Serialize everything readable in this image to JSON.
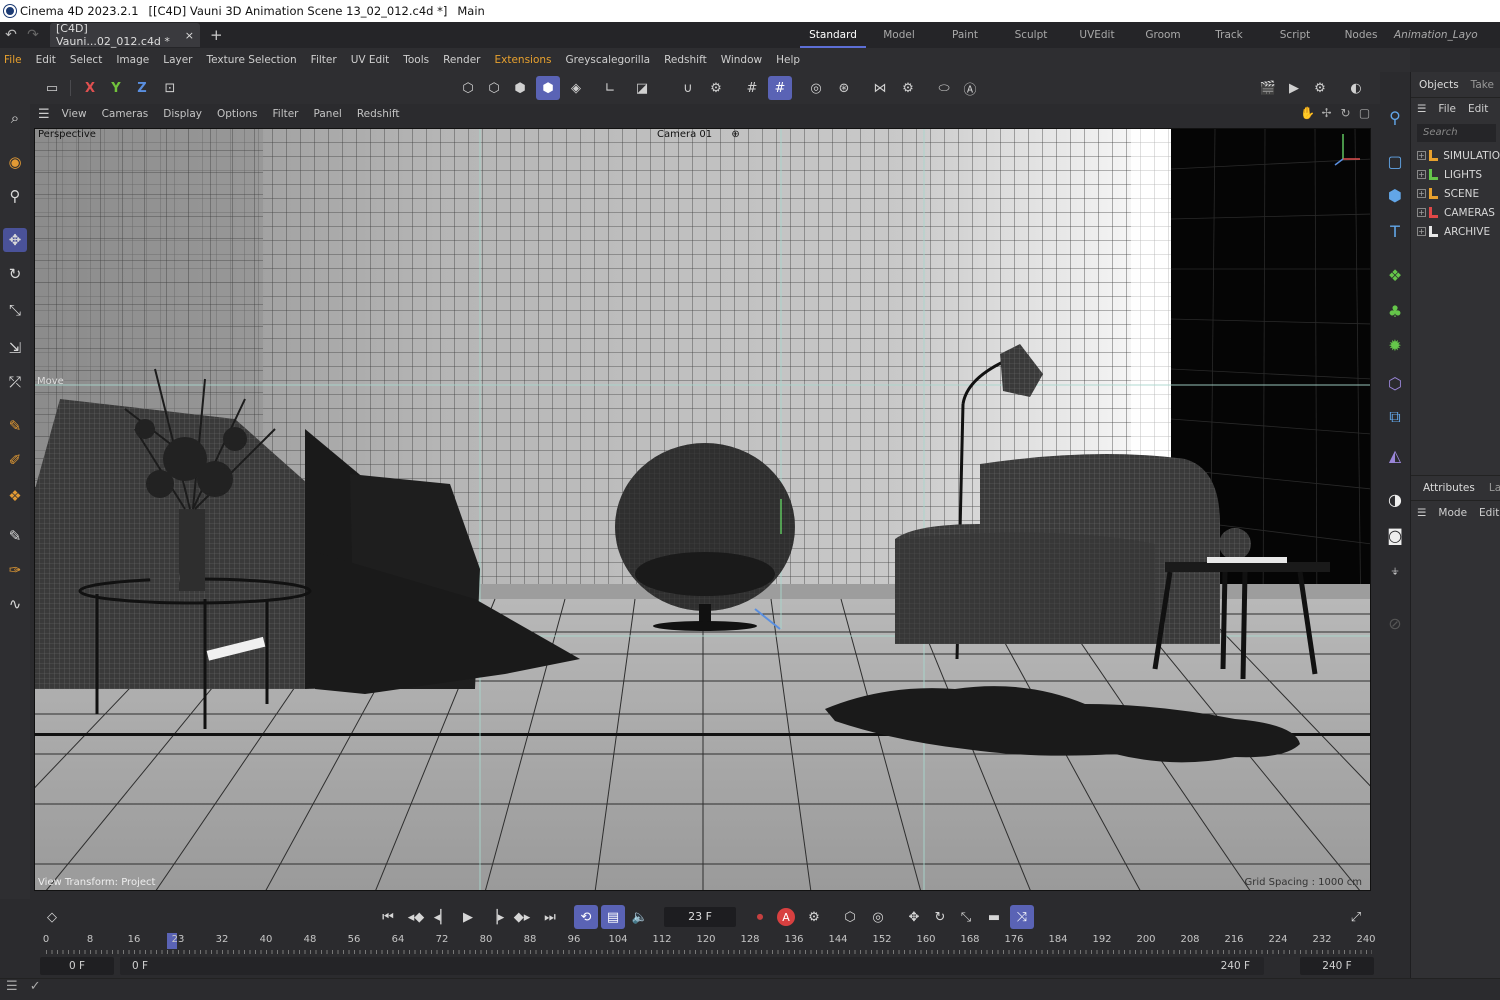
{
  "window": {
    "app_version": "Cinema 4D 2023.2.1",
    "document_title": "[[C4D] Vauni 3D Animation Scene 13_02_012.c4d *]",
    "layout_name": "Main"
  },
  "tabs": {
    "document_tab": "[C4D] Vauni...02_012.c4d *",
    "close": "×",
    "add": "+"
  },
  "layouts": [
    "Standard",
    "Model",
    "Paint",
    "Sculpt",
    "UVEdit",
    "Groom",
    "Track",
    "Script",
    "Nodes",
    "Animation_Layo"
  ],
  "menu": [
    "File",
    "Edit",
    "Select",
    "Image",
    "Layer",
    "Texture Selection",
    "Filter",
    "UV Edit",
    "Tools",
    "Render",
    "Extensions",
    "Greyscalegorilla",
    "Redshift",
    "Window",
    "Help"
  ],
  "toolbar": {
    "axis_x": "X",
    "axis_y": "Y",
    "axis_z": "Z"
  },
  "viewport": {
    "menu": [
      "View",
      "Cameras",
      "Display",
      "Options",
      "Filter",
      "Panel",
      "Redshift"
    ],
    "projection": "Perspective",
    "camera": "Camera 01",
    "camera_suffix": "⊕",
    "tool_label": "Move",
    "view_transform": "View Transform: Project",
    "grid_spacing": "Grid Spacing : 1000 cm"
  },
  "timeline": {
    "current_frame": "23 F",
    "current_frame_value": 23,
    "ticks": [
      "0",
      "8",
      "16",
      "23",
      "32",
      "40",
      "48",
      "56",
      "64",
      "72",
      "80",
      "88",
      "96",
      "104",
      "112",
      "120",
      "128",
      "136",
      "144",
      "152",
      "160",
      "168",
      "176",
      "184",
      "192",
      "200",
      "208",
      "216",
      "224",
      "232",
      "240"
    ],
    "range_start": "0 F",
    "range_min": "0 F",
    "range_max": "240 F",
    "range_end": "240 F"
  },
  "objects_panel": {
    "tab_objects": "Objects",
    "tab_takes": "Take",
    "menu_file": "File",
    "menu_edit": "Edit",
    "search_placeholder": "Search",
    "items": [
      {
        "name": "SIMULATIO",
        "color": "#e8a12e"
      },
      {
        "name": "LIGHTS",
        "color": "#65c64a"
      },
      {
        "name": "SCENE",
        "color": "#e8a12e"
      },
      {
        "name": "CAMERAS",
        "color": "#e04848"
      },
      {
        "name": "ARCHIVE",
        "color": "#e8e8e8"
      }
    ]
  },
  "attributes_panel": {
    "tab_attributes": "Attributes",
    "tab_layers": "La",
    "menu_mode": "Mode",
    "menu_edit": "Edit"
  },
  "colors": {
    "accent": "#5a63b5",
    "layout_underline": "#5d6fd6",
    "extension_highlight": "#e8a12e"
  }
}
